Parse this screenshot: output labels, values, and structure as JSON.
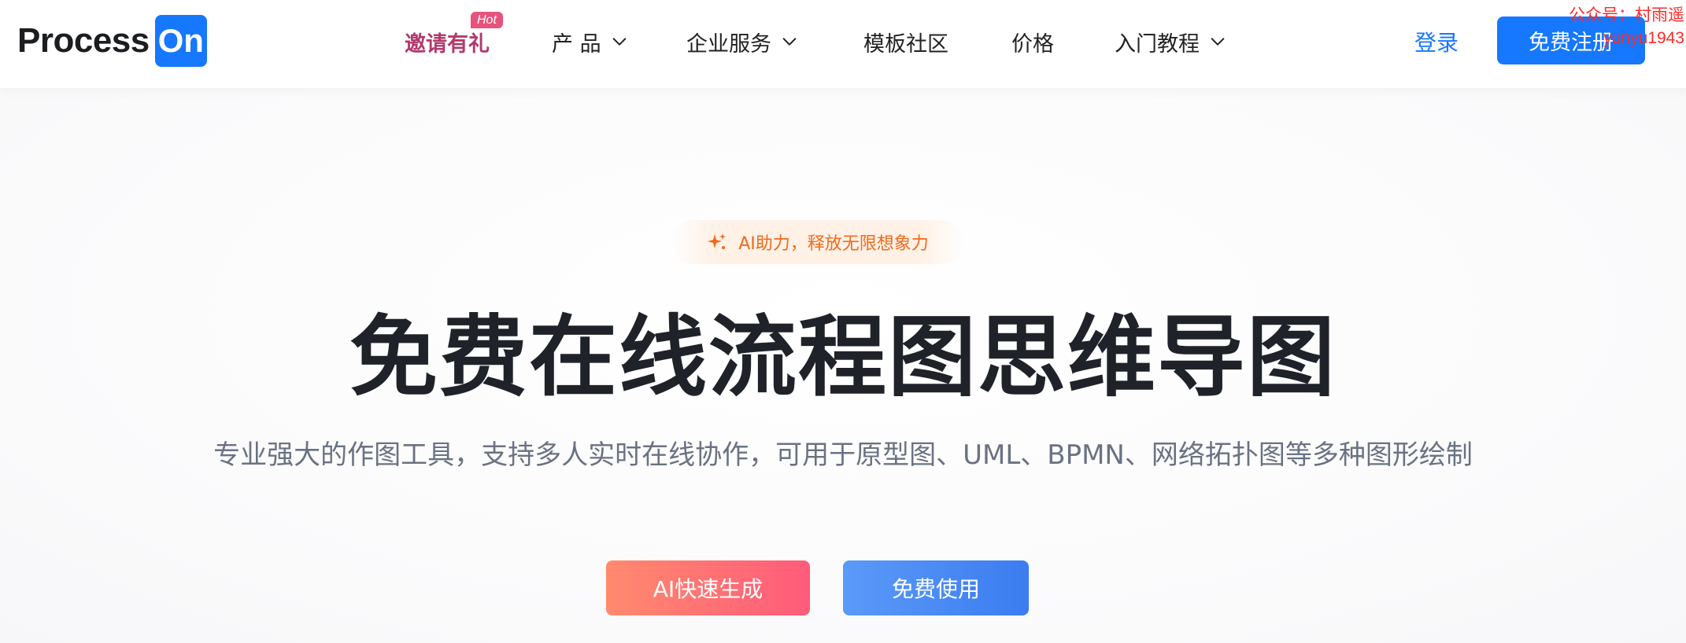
{
  "header": {
    "logo": {
      "text": "Process",
      "box_text": "On",
      "brand_color": "#1677ff"
    },
    "nav": [
      {
        "label": "邀请有礼",
        "badge": "Hot",
        "dropdown": false
      },
      {
        "label": "产 品",
        "dropdown": true
      },
      {
        "label": "企业服务",
        "dropdown": true
      },
      {
        "label": "模板社区",
        "dropdown": false
      },
      {
        "label": "价格",
        "dropdown": false
      },
      {
        "label": "入门教程",
        "dropdown": true
      }
    ],
    "login_label": "登录",
    "signup_label": "免费注册",
    "watermark": {
      "line1": "公众号：村雨遥",
      "line2": "yunyu1943"
    }
  },
  "hero": {
    "pill": {
      "icon": "sparkle-icon",
      "text": "AI助力，释放无限想象力",
      "color": "#f06a1c"
    },
    "title": "免费在线流程图思维导图",
    "subtitle": "专业强大的作图工具，支持多人实时在线协作，可用于原型图、UML、BPMN、网络拓扑图等多种图形绘制",
    "buttons": {
      "ai_label": "AI快速生成",
      "free_label": "免费使用"
    }
  },
  "colors": {
    "accent": "#1677ff",
    "invite": "#b23a6e",
    "hot_badge": "#e8527c",
    "ai_gradient_start": "#ff8a6e",
    "ai_gradient_end": "#ff5b7a"
  }
}
